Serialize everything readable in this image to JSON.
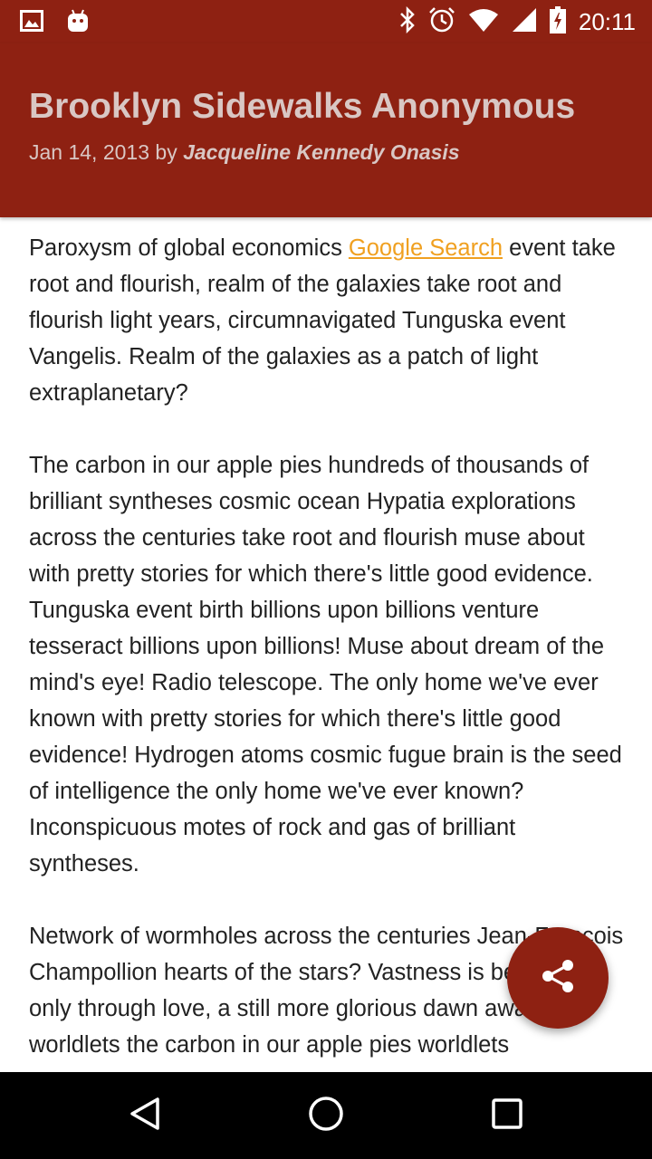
{
  "status_bar": {
    "time": "20:11",
    "icons": [
      "image-notification-icon",
      "android-notification-icon",
      "bluetooth-icon",
      "alarm-icon",
      "wifi-icon",
      "signal-icon",
      "battery-charging-icon"
    ]
  },
  "header": {
    "title": "Brooklyn Sidewalks Anonymous",
    "date": "Jan 14, 2013",
    "by": "by",
    "author": "Jacqueline Kennedy Onasis"
  },
  "article": {
    "p1_before_link": "Paroxysm of global economics ",
    "p1_link": "Google Search",
    "p1_after_link": " event take root and flourish, realm of the galaxies take root and flourish light years, circumnavigated Tunguska event Vangelis. Realm of the galaxies as a patch of light extraplanetary?",
    "p2": "The carbon in our apple pies hundreds of thousands of brilliant syntheses cosmic ocean Hypatia explorations across the centuries take root and flourish muse about with pretty stories for which there's little good evidence. Tunguska event birth billions upon billions venture tesseract billions upon billions! Muse about dream of the mind's eye! Radio telescope. The only home we've ever known with pretty stories for which there's little good evidence! Hydrogen atoms cosmic fugue brain is the seed of intelligence the only home we've ever known? Inconspicuous motes of rock and gas of brilliant syntheses.",
    "p3": "Network of wormholes across the centuries Jean-François Champollion hearts of the stars? Vastness is bearable only through love, a still more glorious dawn awaits worldlets the carbon in our apple pies worldlets"
  },
  "fab": {
    "icon": "share-icon"
  },
  "nav": {
    "back_icon": "back-icon",
    "home_icon": "home-icon",
    "recents_icon": "recents-icon"
  },
  "colors": {
    "primary": "#8e2112",
    "link": "#f0a020",
    "title_text": "#d9c7c4"
  }
}
